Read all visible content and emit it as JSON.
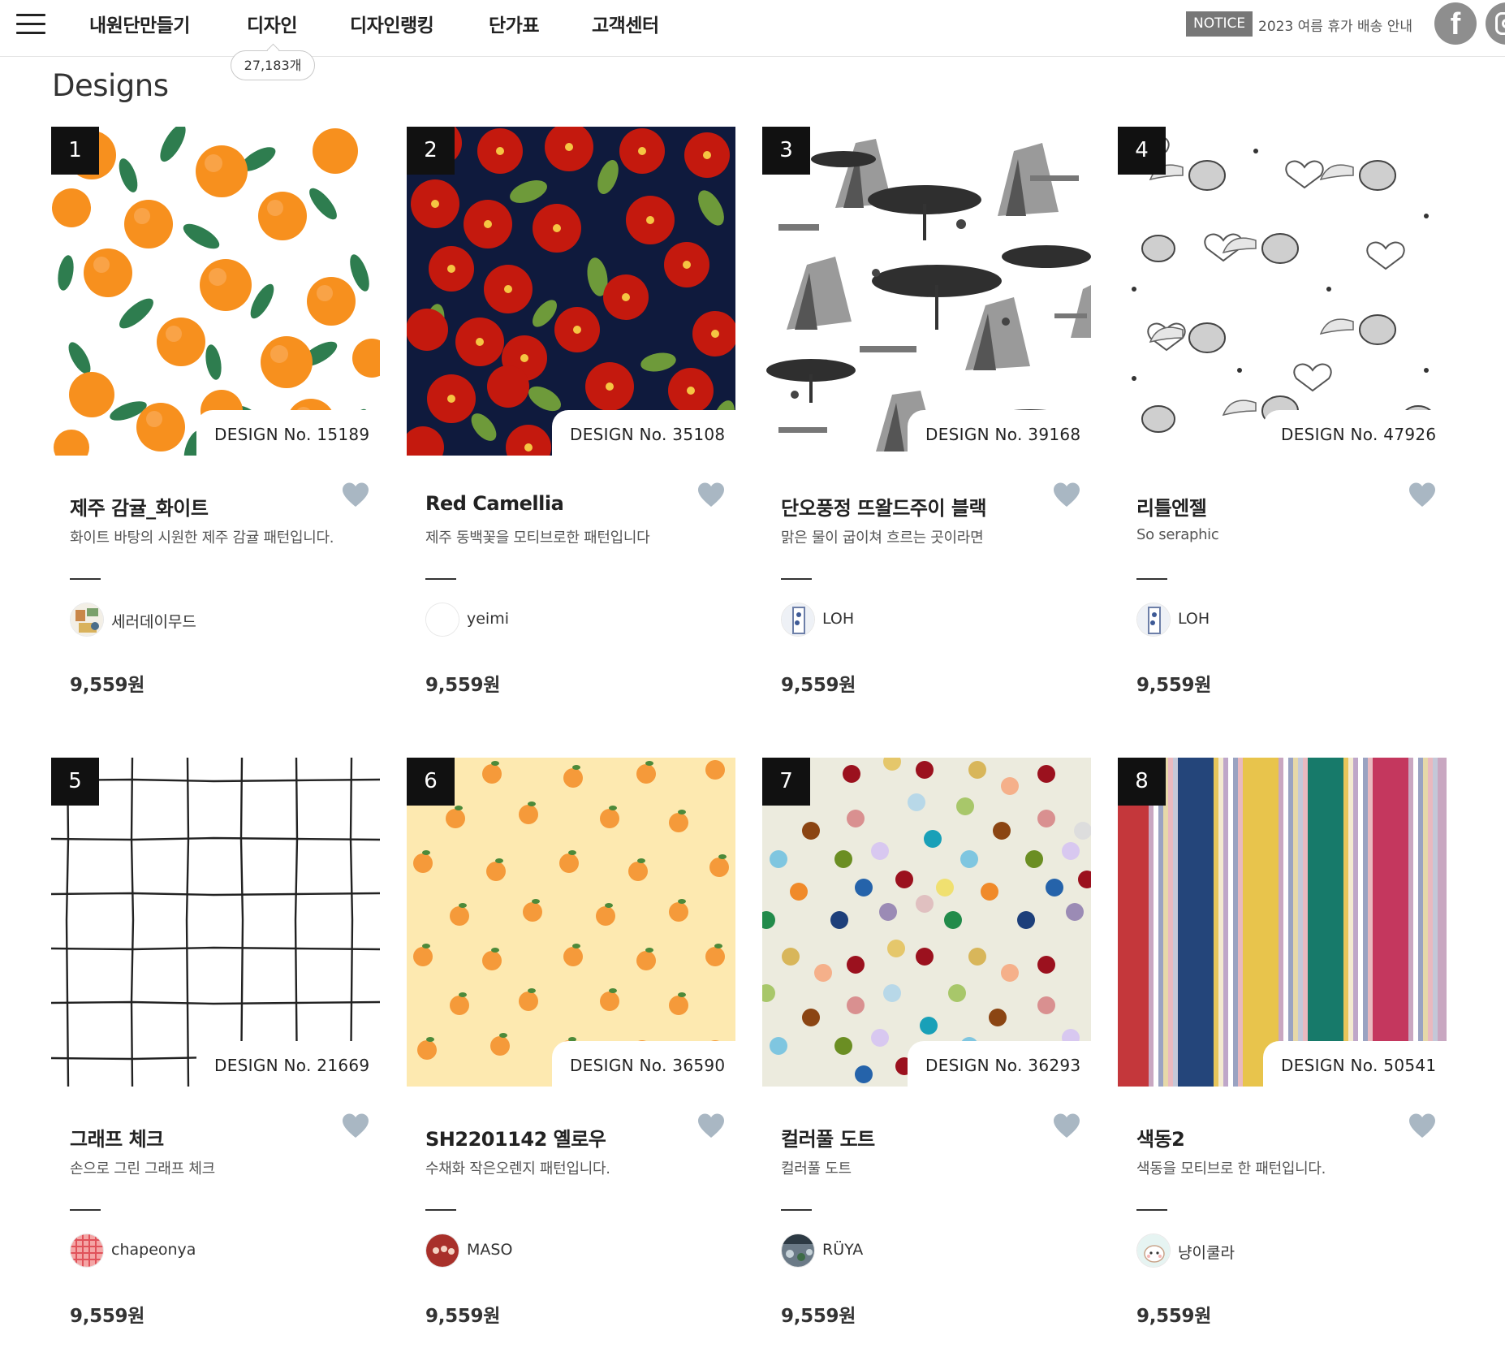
{
  "header": {
    "nav": [
      "내원단만들기",
      "디자인",
      "디자인랭킹",
      "단가표",
      "고객센터"
    ],
    "design_count": "27,183개",
    "notice_label": "NOTICE",
    "notice_text": "2023 여름 휴가 배송 안내",
    "social_icons": [
      "facebook-icon",
      "instagram-icon"
    ]
  },
  "page_title": "Designs",
  "cards": [
    {
      "rank": "1",
      "design_no": "DESIGN No. 15189",
      "title": "제주 감귤_화이트",
      "desc": "화이트 바탕의 시원한 제주 감귤 패턴입니다.",
      "author": "세러데이무드",
      "price": "9,559원"
    },
    {
      "rank": "2",
      "design_no": "DESIGN No. 35108",
      "title": "Red Camellia",
      "desc": "제주 동백꽃을 모티브로한 패턴입니다",
      "author": "yeimi",
      "price": "9,559원"
    },
    {
      "rank": "3",
      "design_no": "DESIGN No. 39168",
      "title": "단오풍정 뜨왈드주이 블랙",
      "desc": "맑은 물이 굽이쳐 흐르는 곳이라면",
      "author": "LOH",
      "price": "9,559원"
    },
    {
      "rank": "4",
      "design_no": "DESIGN No. 47926",
      "title": "리틀엔젤",
      "desc": "So seraphic",
      "author": "LOH",
      "price": "9,559원"
    },
    {
      "rank": "5",
      "design_no": "DESIGN No. 21669",
      "title": "그래프 체크",
      "desc": "손으로 그린 그래프 체크",
      "author": "chapeonya",
      "price": "9,559원"
    },
    {
      "rank": "6",
      "design_no": "DESIGN No. 36590",
      "title": "SH2201142 옐로우",
      "desc": "수채화 작은오렌지 패턴입니다.",
      "author": "MASO",
      "price": "9,559원"
    },
    {
      "rank": "7",
      "design_no": "DESIGN No. 36293",
      "title": "컬러풀 도트",
      "desc": "컬러풀 도트",
      "author": "RÜYA",
      "price": "9,559원"
    },
    {
      "rank": "8",
      "design_no": "DESIGN No. 50541",
      "title": "색동2",
      "desc": "색동을 모티브로 한 패턴입니다.",
      "author": "냥이쿨라",
      "price": "9,559원"
    }
  ],
  "colors": {
    "heart": "#a9b7c3",
    "rank_bg": "#111111",
    "notice_bg": "#777777",
    "social_bg": "#8e8e8e"
  }
}
